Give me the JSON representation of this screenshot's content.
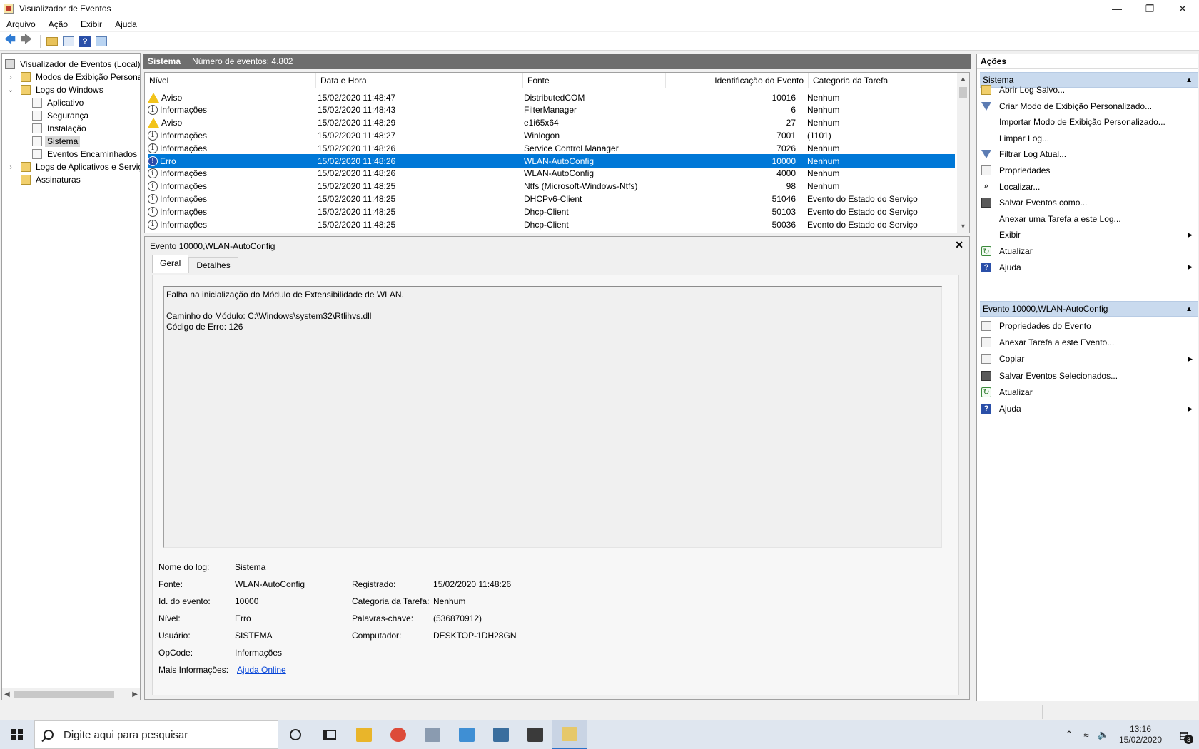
{
  "window": {
    "title": "Visualizador de Eventos",
    "minimize_icon": "minimize-icon",
    "restore_icon": "restore-icon",
    "close_icon": "close-icon"
  },
  "menu": [
    "Arquivo",
    "Ação",
    "Exibir",
    "Ajuda"
  ],
  "tree": {
    "items": [
      {
        "label": "Visualizador de Eventos (Local)",
        "level": 0,
        "expander": "",
        "icon": "local"
      },
      {
        "label": "Modos de Exibição Personalizados",
        "level": 1,
        "expander": "›",
        "icon": "folder"
      },
      {
        "label": "Logs do Windows",
        "level": 1,
        "expander": "⌄",
        "icon": "folder"
      },
      {
        "label": "Aplicativo",
        "level": 2,
        "expander": "",
        "icon": "log"
      },
      {
        "label": "Segurança",
        "level": 2,
        "expander": "",
        "icon": "log"
      },
      {
        "label": "Instalação",
        "level": 2,
        "expander": "",
        "icon": "log"
      },
      {
        "label": "Sistema",
        "level": 2,
        "expander": "",
        "icon": "log",
        "selected": true
      },
      {
        "label": "Eventos Encaminhados",
        "level": 2,
        "expander": "",
        "icon": "log"
      },
      {
        "label": "Logs de Aplicativos e Serviços",
        "level": 1,
        "expander": "›",
        "icon": "folder"
      },
      {
        "label": "Assinaturas",
        "level": 1,
        "expander": "",
        "icon": "folder"
      }
    ]
  },
  "events_header": {
    "title": "Sistema",
    "count": "Número de eventos: 4.802"
  },
  "events_table": {
    "columns": [
      "Nível",
      "Data e Hora",
      "Fonte",
      "Identificação do Evento",
      "Categoria da Tarefa"
    ],
    "rows": [
      {
        "level": "Aviso",
        "icon": "warning",
        "datetime": "15/02/2020 11:48:47",
        "source": "DistributedCOM",
        "id": "10016",
        "category": "Nenhum"
      },
      {
        "level": "Informações",
        "icon": "info",
        "datetime": "15/02/2020 11:48:43",
        "source": "FilterManager",
        "id": "6",
        "category": "Nenhum"
      },
      {
        "level": "Aviso",
        "icon": "warning",
        "datetime": "15/02/2020 11:48:29",
        "source": "e1i65x64",
        "id": "27",
        "category": "Nenhum"
      },
      {
        "level": "Informações",
        "icon": "info",
        "datetime": "15/02/2020 11:48:27",
        "source": "Winlogon",
        "id": "7001",
        "category": "(1101)"
      },
      {
        "level": "Informações",
        "icon": "info",
        "datetime": "15/02/2020 11:48:26",
        "source": "Service Control Manager",
        "id": "7026",
        "category": "Nenhum"
      },
      {
        "level": "Erro",
        "icon": "error",
        "datetime": "15/02/2020 11:48:26",
        "source": "WLAN-AutoConfig",
        "id": "10000",
        "category": "Nenhum",
        "selected": true
      },
      {
        "level": "Informações",
        "icon": "info",
        "datetime": "15/02/2020 11:48:26",
        "source": "WLAN-AutoConfig",
        "id": "4000",
        "category": "Nenhum"
      },
      {
        "level": "Informações",
        "icon": "info",
        "datetime": "15/02/2020 11:48:25",
        "source": "Ntfs (Microsoft-Windows-Ntfs)",
        "id": "98",
        "category": "Nenhum"
      },
      {
        "level": "Informações",
        "icon": "info",
        "datetime": "15/02/2020 11:48:25",
        "source": "DHCPv6-Client",
        "id": "51046",
        "category": "Evento do Estado do Serviço"
      },
      {
        "level": "Informações",
        "icon": "info",
        "datetime": "15/02/2020 11:48:25",
        "source": "Dhcp-Client",
        "id": "50103",
        "category": "Evento do Estado do Serviço"
      },
      {
        "level": "Informações",
        "icon": "info",
        "datetime": "15/02/2020 11:48:25",
        "source": "Dhcp-Client",
        "id": "50036",
        "category": "Evento do Estado do Serviço"
      }
    ]
  },
  "detail": {
    "title": "Evento 10000,WLAN-AutoConfig",
    "tabs": [
      "Geral",
      "Detalhes"
    ],
    "description": "Falha na inicialização do Módulo de Extensibilidade de WLAN.\n\nCaminho do Módulo: C:\\Windows\\system32\\Rtlihvs.dll\nCódigo de Erro: 126",
    "props": {
      "log_name_label": "Nome do log:",
      "log_name": "Sistema",
      "source_label": "Fonte:",
      "source": "WLAN-AutoConfig",
      "logged_label": "Registrado:",
      "logged": "15/02/2020 11:48:26",
      "event_id_label": "Id. do evento:",
      "event_id": "10000",
      "task_category_label": "Categoria da Tarefa:",
      "task_category": "Nenhum",
      "level_label": "Nível:",
      "level": "Erro",
      "keywords_label": "Palavras-chave:",
      "keywords": "(536870912)",
      "user_label": "Usuário:",
      "user": "SISTEMA",
      "computer_label": "Computador:",
      "computer": "DESKTOP-1DH28GN",
      "opcode_label": "OpCode:",
      "opcode": "Informações",
      "more_info_label": "Mais Informações:",
      "more_info_link": "Ajuda Online"
    }
  },
  "actions": {
    "title": "Ações",
    "section1": {
      "title": "Sistema",
      "items": [
        {
          "label": "Abrir Log Salvo...",
          "icon": "folder",
          "submenu": false
        },
        {
          "label": "Criar Modo de Exibição Personalizado...",
          "icon": "filter",
          "submenu": false
        },
        {
          "label": "Importar Modo de Exibição Personalizado...",
          "icon": "none",
          "submenu": false
        },
        {
          "label": "Limpar Log...",
          "icon": "none",
          "submenu": false
        },
        {
          "label": "Filtrar Log Atual...",
          "icon": "filter",
          "submenu": false
        },
        {
          "label": "Propriedades",
          "icon": "box",
          "submenu": false
        },
        {
          "label": "Localizar...",
          "icon": "find",
          "submenu": false
        },
        {
          "label": "Salvar Eventos como...",
          "icon": "save",
          "submenu": false
        },
        {
          "label": "Anexar uma Tarefa a este Log...",
          "icon": "none",
          "submenu": false
        },
        {
          "label": "Exibir",
          "icon": "none",
          "submenu": true
        },
        {
          "label": "Atualizar",
          "icon": "refresh",
          "submenu": false
        },
        {
          "label": "Ajuda",
          "icon": "help",
          "submenu": true
        }
      ]
    },
    "section2": {
      "title": "Evento 10000,WLAN-AutoConfig",
      "items": [
        {
          "label": "Propriedades do Evento",
          "icon": "box",
          "submenu": false
        },
        {
          "label": "Anexar Tarefa a este Evento...",
          "icon": "box",
          "submenu": false
        },
        {
          "label": "Copiar",
          "icon": "box",
          "submenu": true
        },
        {
          "label": "Salvar Eventos Selecionados...",
          "icon": "save",
          "submenu": false
        },
        {
          "label": "Atualizar",
          "icon": "refresh",
          "submenu": false
        },
        {
          "label": "Ajuda",
          "icon": "help",
          "submenu": true
        }
      ]
    }
  },
  "taskbar": {
    "search_placeholder": "Digite aqui para pesquisar",
    "apps": [
      {
        "name": "file-explorer",
        "color": "#e9b52a"
      },
      {
        "name": "chrome",
        "color": "#dd4b39"
      },
      {
        "name": "photos",
        "color": "#8a9bb0"
      },
      {
        "name": "remote-desktop",
        "color": "#3f8fd4"
      },
      {
        "name": "computer-management",
        "color": "#3a6e9e"
      },
      {
        "name": "calculator",
        "color": "#3a3a3a"
      },
      {
        "name": "event-viewer",
        "color": "#e6c86a",
        "active": true
      }
    ],
    "time": "13:16",
    "date": "15/02/2020",
    "notifications": "3"
  }
}
